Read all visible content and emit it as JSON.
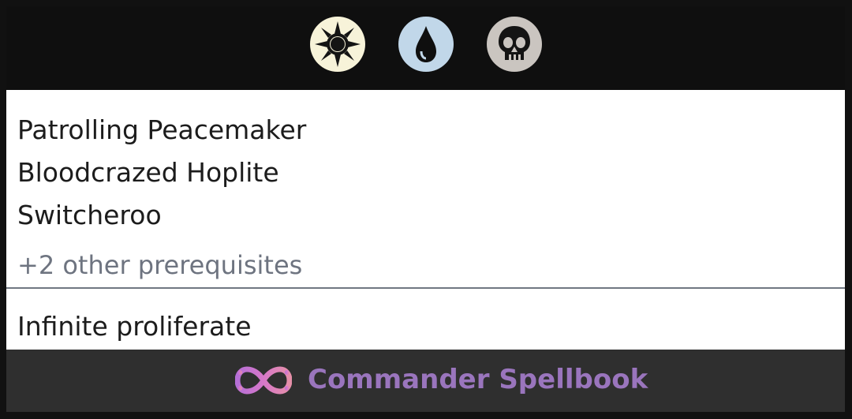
{
  "header": {
    "mana_symbols": [
      {
        "icon": "white-mana-sun-icon",
        "color": "#f7f3d9"
      },
      {
        "icon": "blue-mana-drop-icon",
        "color": "#c1d7e9"
      },
      {
        "icon": "black-mana-skull-icon",
        "color": "#cac5c0"
      }
    ]
  },
  "cards": [
    "Patrolling Peacemaker",
    "Bloodcrazed Hoplite",
    "Switcheroo"
  ],
  "other_prerequisites": "+2 other prerequisites",
  "result": "Infinite proliferate",
  "footer": {
    "brand": "Commander Spellbook",
    "brand_color": "#9a75bd",
    "logo_icon": "infinity-icon"
  }
}
